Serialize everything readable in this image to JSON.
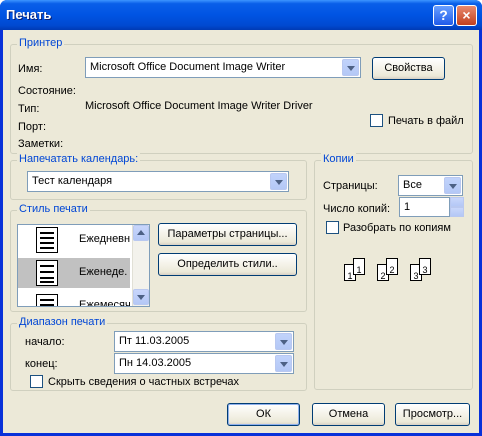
{
  "window": {
    "title": "Печать",
    "help_label": "?",
    "close_label": "×"
  },
  "printer": {
    "group_label": "Принтер",
    "name_label": "Имя:",
    "name_value": "Microsoft Office Document Image Writer",
    "properties_button": "Свойства",
    "status_label": "Состояние:",
    "status_value": "",
    "type_label": "Тип:",
    "type_value": "Microsoft Office Document Image Writer Driver",
    "port_label": "Порт:",
    "port_value": "",
    "comment_label": "Заметки:",
    "comment_value": "",
    "print_to_file_label": "Печать в файл",
    "print_to_file_checked": false
  },
  "calendar": {
    "group_label": "Напечатать календарь:",
    "selected": "Тест календаря"
  },
  "print_style": {
    "group_label": "Стиль печати",
    "items": [
      {
        "label": "Ежедневн",
        "selected": false
      },
      {
        "label": "Еженеде.",
        "selected": true
      },
      {
        "label": "Ежемесяч",
        "selected": false
      }
    ],
    "page_setup_button": "Параметры страницы...",
    "define_styles_button": "Определить стили.."
  },
  "print_range": {
    "group_label": "Диапазон печати",
    "start_label": "начало:",
    "start_value": "Пт 11.03.2005",
    "end_label": "конец:",
    "end_value": "Пн 14.03.2005",
    "hide_private_label": "Скрыть сведения о частных встречах",
    "hide_private_checked": false
  },
  "copies": {
    "group_label": "Копии",
    "pages_label": "Страницы:",
    "pages_value": "Все",
    "count_label": "Число копий:",
    "count_value": "1",
    "collate_label": "Разобрать по копиям",
    "collate_checked": false,
    "collate_pages": [
      "1",
      "1",
      "2",
      "2",
      "3",
      "3"
    ]
  },
  "footer": {
    "ok_button": "ОК",
    "cancel_button": "Отмена",
    "preview_button": "Просмотр..."
  }
}
